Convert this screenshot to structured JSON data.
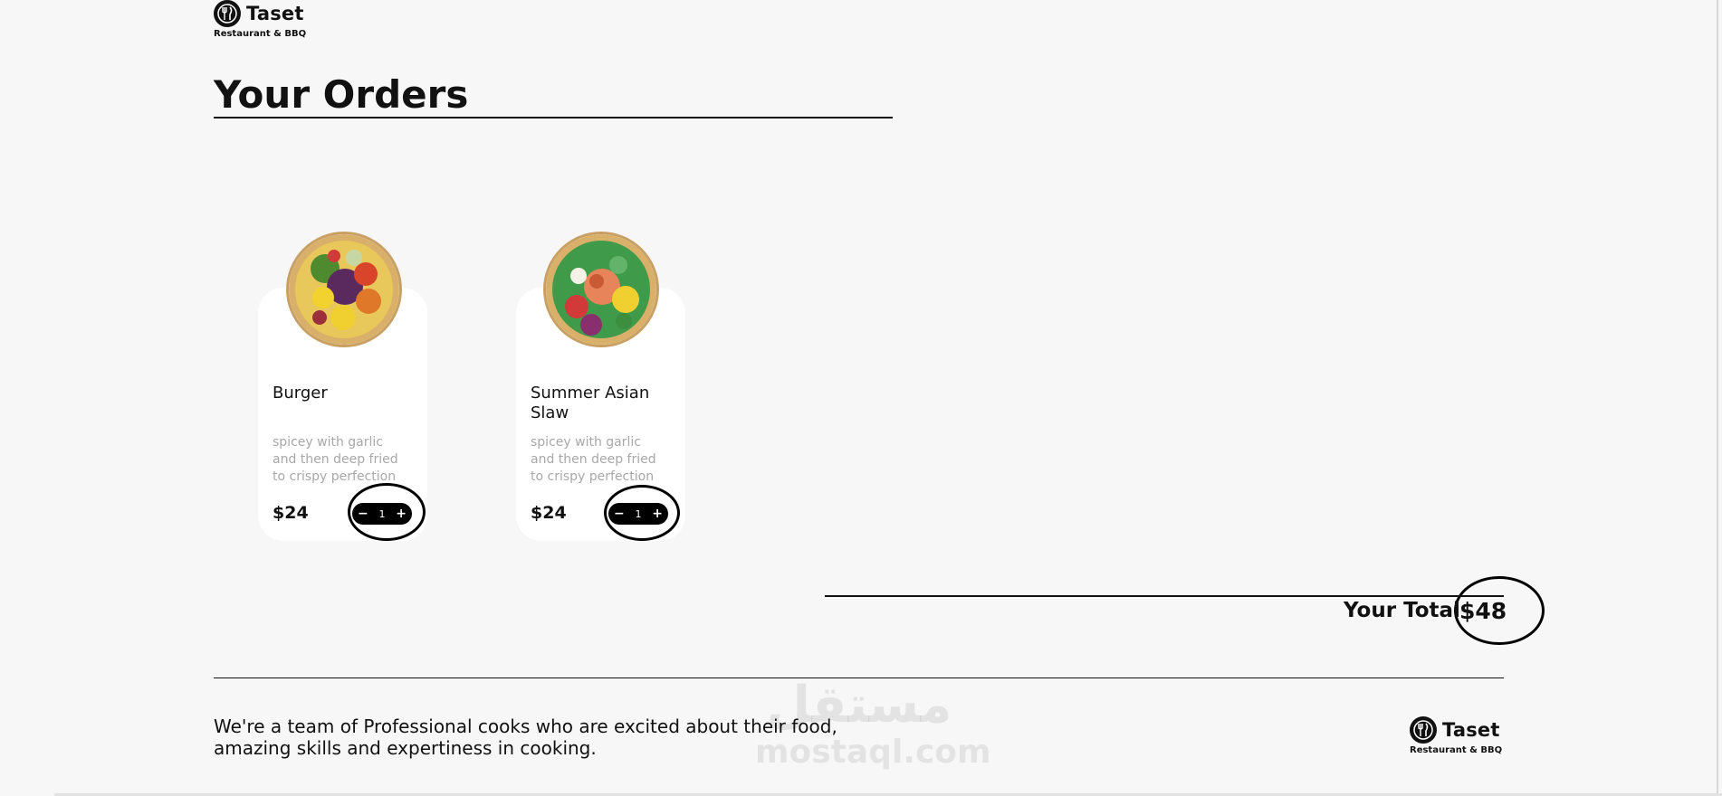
{
  "brand": {
    "name": "Taset",
    "tagline": "Restaurant & BBQ"
  },
  "page": {
    "title": "Your Orders"
  },
  "orders": [
    {
      "name": "Burger",
      "description": "spicey with garlic and then deep fried to crispy perfection",
      "price": "$24",
      "quantity": "1"
    },
    {
      "name": "Summer Asian Slaw",
      "description": "spicey with garlic and then deep fried to crispy perfection",
      "price": "$24",
      "quantity": "1"
    }
  ],
  "stepper": {
    "decrement": "−",
    "increment": "+"
  },
  "total": {
    "label": "Your Total",
    "value": "$48"
  },
  "footer": {
    "about": "We're a team of Professional cooks who are excited about their food, amazing skills and expertiness in cooking."
  },
  "watermark": {
    "arabic": "مستقل",
    "latin": "mostaql.com"
  },
  "colors": {
    "background": "#f7f7f7",
    "card": "#ffffff",
    "text": "#111111",
    "muted": "#a8a8a8",
    "stepper": "#000000"
  }
}
